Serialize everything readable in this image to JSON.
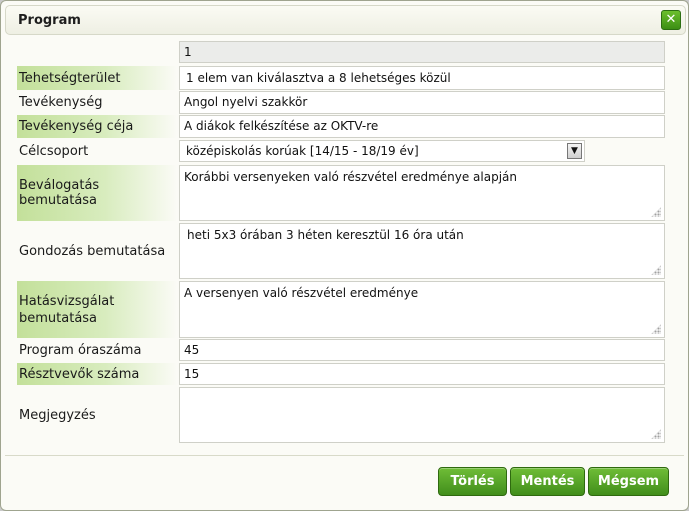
{
  "dialog": {
    "title": "Program",
    "close_symbol": "✕",
    "close_icon": "close-icon"
  },
  "form": {
    "id_value": "1",
    "talent_area": {
      "label": "Tehetségterület",
      "value": "1 elem van kiválasztva a 8 lehetséges közül"
    },
    "activity": {
      "label": "Tevékenység",
      "value": "Angol nyelvi szakkör"
    },
    "activity_goal": {
      "label": "Tevékenység céja",
      "value": "A diákok felkészítése az OKTV-re"
    },
    "target_group": {
      "label": "Célcsoport",
      "value": "középiskolás korúak [14/15 - 18/19 év]",
      "dropdown_symbol": "▼"
    },
    "selection": {
      "label": "Beválogatás bemutatása",
      "value": "Korábbi versenyeken való részvétel eredménye alapján"
    },
    "care": {
      "label": "Gondozás bemutatása",
      "value": "heti 5x3 órában 3 héten keresztül 16 óra után"
    },
    "impact": {
      "label": "Hatásvizsgálat bemutatása",
      "value": "A versenyen való részvétel eredménye"
    },
    "hours": {
      "label": "Program óraszáma",
      "value": "45"
    },
    "participants": {
      "label": "Résztvevők száma",
      "value": "15"
    },
    "note": {
      "label": "Megjegyzés",
      "value": ""
    }
  },
  "buttons": {
    "delete": "Törlés",
    "save": "Mentés",
    "cancel": "Mégsem"
  },
  "colors": {
    "accent_green": "#4a9a1f",
    "label_highlight": "#c3e09a"
  }
}
